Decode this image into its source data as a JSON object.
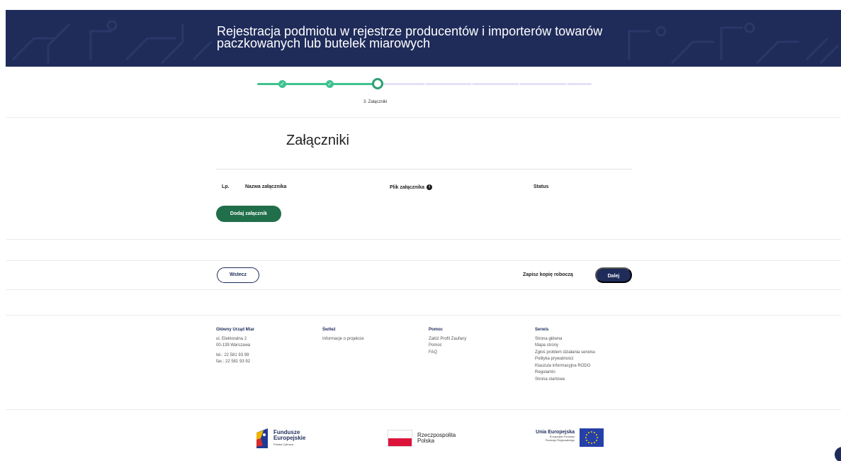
{
  "header": {
    "title_line1": "Rejestracja podmiotu w rejestrze producentów i importerów towarów",
    "title_line2": "paczkowanych lub butelek miarowych"
  },
  "stepper": {
    "current_label": "3. Załączniki",
    "current_step": 3,
    "total_steps": 8,
    "done_color": "#3ec28f",
    "todo_color": "#e3e2f8"
  },
  "section": {
    "title": "Załączniki"
  },
  "table": {
    "columns": [
      "Lp.",
      "Nazwa załącznika",
      "Plik załącznika",
      "Status"
    ]
  },
  "buttons": {
    "add_attachment": "Dodaj załącznik",
    "back": "Wstecz",
    "save_draft": "Zapisz kopię roboczą",
    "next": "Dalej"
  },
  "footer": {
    "col1": {
      "heading": "Główny Urząd Miar",
      "address1": "ul. Elektoralna 2",
      "address2": "00-139 Warszawa",
      "tel": "tel.: 22 581 93 99",
      "fax": "fax.: 22 581 93 92"
    },
    "col2": {
      "heading": "Świteź",
      "items": [
        "Informacje o projekcie"
      ]
    },
    "col3": {
      "heading": "Pomoc",
      "items": [
        "Załóż Profil Zaufany",
        "Pomoc",
        "FAQ"
      ]
    },
    "col4": {
      "heading": "Serwis",
      "items": [
        "Strona główna",
        "Mapa strony",
        "Zgłoś problem działania serwisu",
        "Polityka prywatności",
        "Klauzula informacyjna RODO",
        "Regulamin",
        "Strona startowa"
      ]
    }
  },
  "logos": {
    "fe_line1": "Fundusze",
    "fe_line2": "Europejskie",
    "fe_sub": "Polska Cyfrowa",
    "pl_line1": "Rzeczpospolita",
    "pl_line2": "Polska",
    "ue_title": "Unia Europejska",
    "ue_sub1": "Europejski Fundusz",
    "ue_sub2": "Rozwoju Regionalnego"
  },
  "colors": {
    "brand_navy": "#1f2c5a",
    "brand_green": "#216e4a"
  }
}
